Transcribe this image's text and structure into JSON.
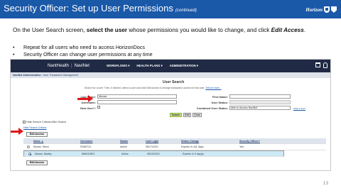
{
  "slide": {
    "title": "Security Officer: Set up User Permissions",
    "title_suffix": "(continued)",
    "brand": "Horizon",
    "intro_1": "On the User Search screen,",
    "intro_bold_1": "select the user",
    "intro_2": "whose permissions  you would like to change, and click",
    "intro_italic": "Edit Access",
    "intro_end": ".",
    "bullets": [
      "Repeat for all users who need to access HorizonDocs",
      "Security Officer can change user permissions at any time"
    ],
    "page_number": "13"
  },
  "navinet": {
    "logo_left": "NantHealth",
    "logo_sep": "|",
    "logo_right": "NaviNet",
    "nav": [
      "WORKFLOWS ▾",
      "HEALTH PLANS ▾",
      "ADMINISTRATION ▾"
    ],
    "breadcrumb_1": "NaviNet Administration",
    "breadcrumb_sep": "›",
    "breadcrumb_2": "User Transaction Management",
    "panel_title": "User Search",
    "help_text": "Search for a user. Then, if desired, select a user and click Edit Access to change transaction access for that user.",
    "help_link": "Tell me more...",
    "last_name_label": "Last Name:",
    "last_name_value": "Moose",
    "username_label": "Username:",
    "username_value": "",
    "new_user_label": "New User?:",
    "first_name_label": "First Name:",
    "first_name_value": "",
    "user_status_label": "User Status:",
    "user_status_value": "",
    "combined_label": "Combined User Status:",
    "combined_value": "Able to Access NaviNet",
    "what_link": "What is this?",
    "btn_search": "Search",
    "btn_edit": "Edit",
    "btn_clear": "Clear",
    "hide_search_label": "Hide Search Criteria After Search",
    "hide_link": "Hide Search Criteria",
    "edit_access_top": "Edit Access",
    "edit_access_bottom": "Edit Access",
    "columns": [
      "Name ▲",
      "Username",
      "Status",
      "Last Login",
      "Status Change",
      "Security Officer?"
    ],
    "rows": [
      {
        "name": "Moose, Steve",
        "username": "SSWITZL",
        "status": "Active",
        "last_login": "05/17/2021",
        "status_change": "Expires in 441 days",
        "security_officer": "Yes",
        "selected": false
      },
      {
        "name": "Moose, Marley",
        "username": "MMOOSE1",
        "status": "Active",
        "last_login": "05/10/2021",
        "status_change": "Expires in 3 day(s)",
        "security_officer": "",
        "selected": true
      }
    ]
  }
}
